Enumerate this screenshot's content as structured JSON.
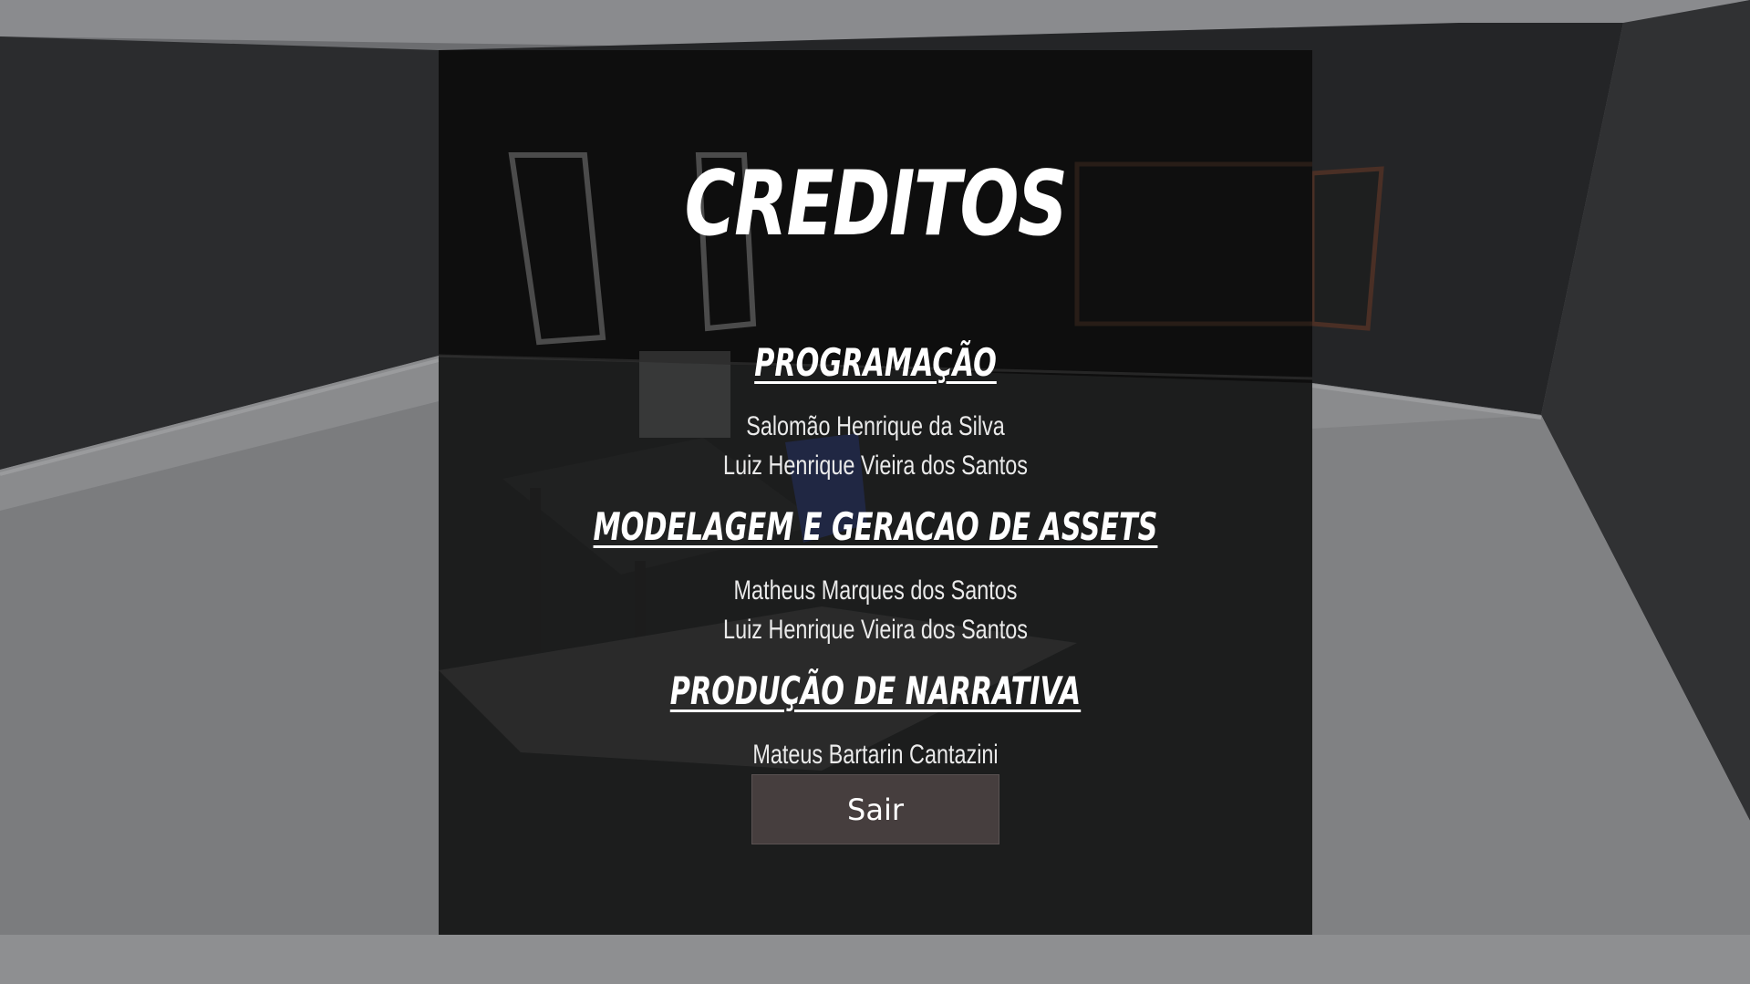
{
  "credits": {
    "title": "CREDITOS",
    "sections": [
      {
        "heading": "PROGRAMAÇÃO",
        "names": [
          "Salomão Henrique da Silva",
          "Luiz Henrique Vieira dos Santos"
        ]
      },
      {
        "heading": "MODELAGEM E GERACAO DE ASSETS",
        "names": [
          "Matheus Marques dos Santos",
          "Luiz Henrique Vieira dos Santos"
        ]
      },
      {
        "heading": "PRODUÇÃO DE NARRATIVA",
        "names": [
          "Mateus Bartarin Cantazini"
        ]
      }
    ],
    "exit_label": "Sair"
  },
  "colors": {
    "panel_bg": "#0a0a0a",
    "button_bg": "#463e3e",
    "text": "#ffffff"
  }
}
